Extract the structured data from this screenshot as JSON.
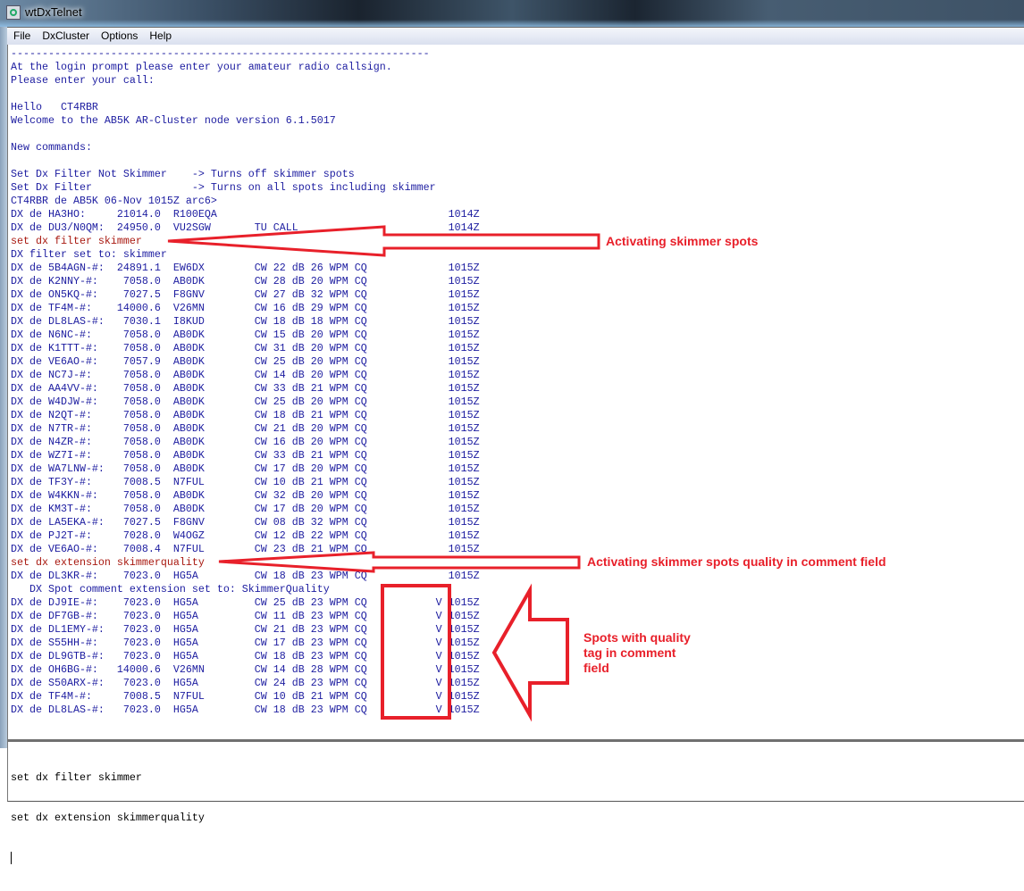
{
  "window": {
    "title": "wtDxTelnet"
  },
  "menu": [
    "File",
    "DxCluster",
    "Options",
    "Help"
  ],
  "terminal": {
    "lines": [
      {
        "text": "-------------------------------------------------------------------",
        "color": "blue"
      },
      {
        "text": "At the login prompt please enter your amateur radio callsign.",
        "color": "blue"
      },
      {
        "text": "Please enter your call:",
        "color": "blue"
      },
      {
        "text": "",
        "color": "blue"
      },
      {
        "text": "Hello   CT4RBR",
        "color": "blue"
      },
      {
        "text": "Welcome to the AB5K AR-Cluster node version 6.1.5017",
        "color": "blue"
      },
      {
        "text": "",
        "color": "blue"
      },
      {
        "text": "New commands:",
        "color": "blue"
      },
      {
        "text": "",
        "color": "blue"
      },
      {
        "text": "Set Dx Filter Not Skimmer    -> Turns off skimmer spots",
        "color": "blue"
      },
      {
        "text": "Set Dx Filter                -> Turns on all spots including skimmer",
        "color": "blue"
      },
      {
        "text": "CT4RBR de AB5K 06-Nov 1015Z arc6>",
        "color": "blue"
      },
      {
        "spot": {
          "spotter": "HA3HO:",
          "freq": "21014.0",
          "call": "R100EQA",
          "comment": "",
          "quality": "",
          "time": "1014Z"
        }
      },
      {
        "spot": {
          "spotter": "DU3/N0QM:",
          "freq": "24950.0",
          "call": "VU2SGW",
          "comment": "TU CALL",
          "quality": "",
          "time": "1014Z"
        }
      },
      {
        "text": "set dx filter skimmer",
        "color": "red"
      },
      {
        "text": "DX filter set to: skimmer",
        "color": "blue"
      },
      {
        "spot": {
          "spotter": "5B4AGN-#:",
          "freq": "24891.1",
          "call": "EW6DX",
          "comment": "CW 22 dB 26 WPM CQ",
          "quality": "",
          "time": "1015Z"
        }
      },
      {
        "spot": {
          "spotter": "K2NNY-#:",
          "freq": "7058.0",
          "call": "AB0DK",
          "comment": "CW 28 dB 20 WPM CQ",
          "quality": "",
          "time": "1015Z"
        }
      },
      {
        "spot": {
          "spotter": "ON5KQ-#:",
          "freq": "7027.5",
          "call": "F8GNV",
          "comment": "CW 27 dB 32 WPM CQ",
          "quality": "",
          "time": "1015Z"
        }
      },
      {
        "spot": {
          "spotter": "TF4M-#:",
          "freq": "14000.6",
          "call": "V26MN",
          "comment": "CW 16 dB 29 WPM CQ",
          "quality": "",
          "time": "1015Z"
        }
      },
      {
        "spot": {
          "spotter": "DL8LAS-#:",
          "freq": "7030.1",
          "call": "I8KUD",
          "comment": "CW 18 dB 18 WPM CQ",
          "quality": "",
          "time": "1015Z"
        }
      },
      {
        "spot": {
          "spotter": "N6NC-#:",
          "freq": "7058.0",
          "call": "AB0DK",
          "comment": "CW 15 dB 20 WPM CQ",
          "quality": "",
          "time": "1015Z"
        }
      },
      {
        "spot": {
          "spotter": "K1TTT-#:",
          "freq": "7058.0",
          "call": "AB0DK",
          "comment": "CW 31 dB 20 WPM CQ",
          "quality": "",
          "time": "1015Z"
        }
      },
      {
        "spot": {
          "spotter": "VE6AO-#:",
          "freq": "7057.9",
          "call": "AB0DK",
          "comment": "CW 25 dB 20 WPM CQ",
          "quality": "",
          "time": "1015Z"
        }
      },
      {
        "spot": {
          "spotter": "NC7J-#:",
          "freq": "7058.0",
          "call": "AB0DK",
          "comment": "CW 14 dB 20 WPM CQ",
          "quality": "",
          "time": "1015Z"
        }
      },
      {
        "spot": {
          "spotter": "AA4VV-#:",
          "freq": "7058.0",
          "call": "AB0DK",
          "comment": "CW 33 dB 21 WPM CQ",
          "quality": "",
          "time": "1015Z"
        }
      },
      {
        "spot": {
          "spotter": "W4DJW-#:",
          "freq": "7058.0",
          "call": "AB0DK",
          "comment": "CW 25 dB 20 WPM CQ",
          "quality": "",
          "time": "1015Z"
        }
      },
      {
        "spot": {
          "spotter": "N2QT-#:",
          "freq": "7058.0",
          "call": "AB0DK",
          "comment": "CW 18 dB 21 WPM CQ",
          "quality": "",
          "time": "1015Z"
        }
      },
      {
        "spot": {
          "spotter": "N7TR-#:",
          "freq": "7058.0",
          "call": "AB0DK",
          "comment": "CW 21 dB 20 WPM CQ",
          "quality": "",
          "time": "1015Z"
        }
      },
      {
        "spot": {
          "spotter": "N4ZR-#:",
          "freq": "7058.0",
          "call": "AB0DK",
          "comment": "CW 16 dB 20 WPM CQ",
          "quality": "",
          "time": "1015Z"
        }
      },
      {
        "spot": {
          "spotter": "WZ7I-#:",
          "freq": "7058.0",
          "call": "AB0DK",
          "comment": "CW 33 dB 21 WPM CQ",
          "quality": "",
          "time": "1015Z"
        }
      },
      {
        "spot": {
          "spotter": "WA7LNW-#:",
          "freq": "7058.0",
          "call": "AB0DK",
          "comment": "CW 17 dB 20 WPM CQ",
          "quality": "",
          "time": "1015Z"
        }
      },
      {
        "spot": {
          "spotter": "TF3Y-#:",
          "freq": "7008.5",
          "call": "N7FUL",
          "comment": "CW 10 dB 21 WPM CQ",
          "quality": "",
          "time": "1015Z"
        }
      },
      {
        "spot": {
          "spotter": "W4KKN-#:",
          "freq": "7058.0",
          "call": "AB0DK",
          "comment": "CW 32 dB 20 WPM CQ",
          "quality": "",
          "time": "1015Z"
        }
      },
      {
        "spot": {
          "spotter": "KM3T-#:",
          "freq": "7058.0",
          "call": "AB0DK",
          "comment": "CW 17 dB 20 WPM CQ",
          "quality": "",
          "time": "1015Z"
        }
      },
      {
        "spot": {
          "spotter": "LA5EKA-#:",
          "freq": "7027.5",
          "call": "F8GNV",
          "comment": "CW 08 dB 32 WPM CQ",
          "quality": "",
          "time": "1015Z"
        }
      },
      {
        "spot": {
          "spotter": "PJ2T-#:",
          "freq": "7028.0",
          "call": "W4OGZ",
          "comment": "CW 12 dB 22 WPM CQ",
          "quality": "",
          "time": "1015Z"
        }
      },
      {
        "spot": {
          "spotter": "VE6AO-#:",
          "freq": "7008.4",
          "call": "N7FUL",
          "comment": "CW 23 dB 21 WPM CQ",
          "quality": "",
          "time": "1015Z"
        }
      },
      {
        "text": "set dx extension skimmerquality",
        "color": "red"
      },
      {
        "spot": {
          "spotter": "DL3KR-#:",
          "freq": "7023.0",
          "call": "HG5A",
          "comment": "CW 18 dB 23 WPM CQ",
          "quality": "",
          "time": "1015Z"
        }
      },
      {
        "text": "   DX Spot comment extension set to: SkimmerQuality",
        "color": "blue"
      },
      {
        "spot": {
          "spotter": "DJ9IE-#:",
          "freq": "7023.0",
          "call": "HG5A",
          "comment": "CW 25 dB 23 WPM CQ",
          "quality": "V",
          "time": "1015Z"
        }
      },
      {
        "spot": {
          "spotter": "DF7GB-#:",
          "freq": "7023.0",
          "call": "HG5A",
          "comment": "CW 11 dB 23 WPM CQ",
          "quality": "V",
          "time": "1015Z"
        }
      },
      {
        "spot": {
          "spotter": "DL1EMY-#:",
          "freq": "7023.0",
          "call": "HG5A",
          "comment": "CW 21 dB 23 WPM CQ",
          "quality": "V",
          "time": "1015Z"
        }
      },
      {
        "spot": {
          "spotter": "S55HH-#:",
          "freq": "7023.0",
          "call": "HG5A",
          "comment": "CW 17 dB 23 WPM CQ",
          "quality": "V",
          "time": "1015Z"
        }
      },
      {
        "spot": {
          "spotter": "DL9GTB-#:",
          "freq": "7023.0",
          "call": "HG5A",
          "comment": "CW 18 dB 23 WPM CQ",
          "quality": "V",
          "time": "1015Z"
        }
      },
      {
        "spot": {
          "spotter": "OH6BG-#:",
          "freq": "14000.6",
          "call": "V26MN",
          "comment": "CW 14 dB 28 WPM CQ",
          "quality": "V",
          "time": "1015Z"
        }
      },
      {
        "spot": {
          "spotter": "S50ARX-#:",
          "freq": "7023.0",
          "call": "HG5A",
          "comment": "CW 24 dB 23 WPM CQ",
          "quality": "V",
          "time": "1015Z"
        }
      },
      {
        "spot": {
          "spotter": "TF4M-#:",
          "freq": "7008.5",
          "call": "N7FUL",
          "comment": "CW 10 dB 21 WPM CQ",
          "quality": "V",
          "time": "1015Z"
        }
      },
      {
        "spot": {
          "spotter": "DL8LAS-#:",
          "freq": "7023.0",
          "call": "HG5A",
          "comment": "CW 18 dB 23 WPM CQ",
          "quality": "V",
          "time": "1015Z"
        }
      }
    ]
  },
  "input": {
    "lines": [
      "set dx filter skimmer",
      "set dx extension skimmerquality"
    ]
  },
  "annotations": {
    "filter": "Activating skimmer spots",
    "extension": "Activating skimmer spots quality in comment field",
    "quality_line1": "Spots with quality",
    "quality_line2": "tag in comment",
    "quality_line3": "field",
    "color": "#e8202a"
  }
}
